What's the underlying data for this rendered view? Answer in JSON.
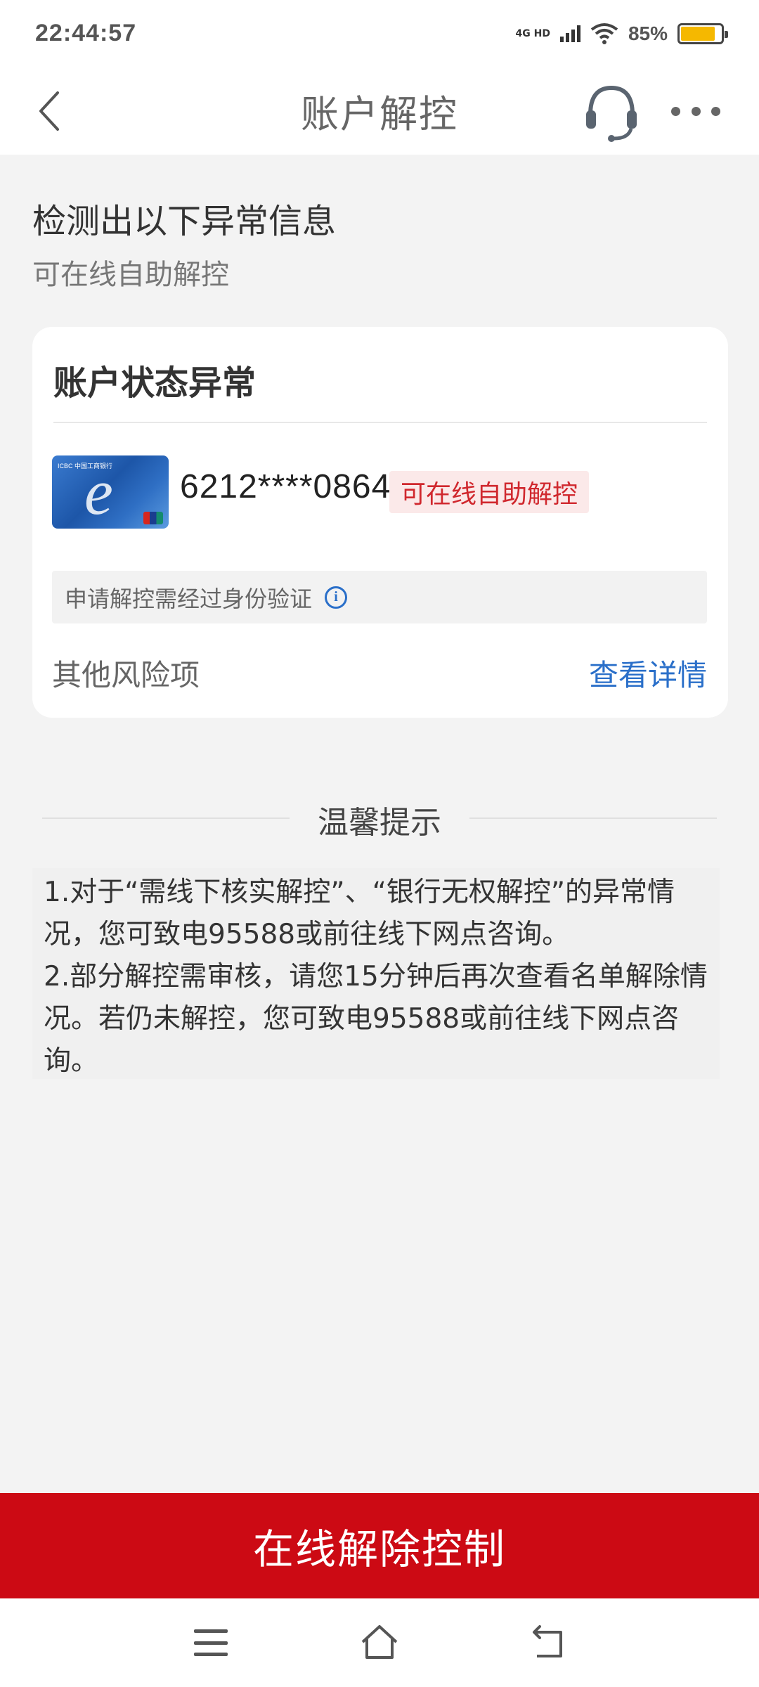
{
  "status_bar": {
    "time": "22:44:57",
    "network": "4G HD",
    "battery": "85%",
    "battery_level": 0.85,
    "icons": [
      "signal-icon",
      "wifi-icon",
      "battery-icon"
    ]
  },
  "nav": {
    "title": "账户解控",
    "icons": [
      "back-arrow-icon",
      "headset-icon",
      "more-dots-icon"
    ]
  },
  "intro": {
    "title": "检测出以下异常信息",
    "subtitle": "可在线自助解控"
  },
  "card": {
    "title": "账户状态异常",
    "bank_logo": "ICBC 中国工商银行",
    "account_number": "6212****0864",
    "status_tag": "可在线自助解控",
    "verify_note": "申请解控需经过身份验证",
    "other_risk_label": "其他风险项",
    "view_detail_label": "查看详情"
  },
  "tips": {
    "title": "温馨提示",
    "items": [
      "1.对于“需线下核实解控”、“银行无权解控”的异常情况，您可致电95588或前往线下网点咨询。",
      "2.部分解控需审核，请您15分钟后再次查看名单解除情况。若仍未解控，您可致电95588或前往线下网点咨询。"
    ]
  },
  "primary_button": {
    "label": "在线解除控制"
  },
  "system_nav": {
    "icons": [
      "menu-icon",
      "home-icon",
      "back-icon"
    ]
  },
  "colors": {
    "accent_red": "#cc0a14",
    "link_blue": "#2a6fc9",
    "tag_red": "#d0282e",
    "battery_yellow": "#f5b800"
  }
}
